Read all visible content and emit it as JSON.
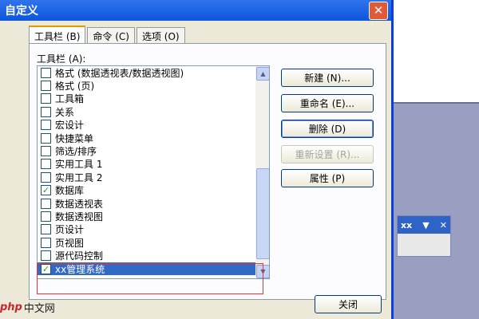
{
  "window": {
    "title": "自定义"
  },
  "tabs": [
    {
      "label": "工具栏 (B)",
      "active": true
    },
    {
      "label": "命令 (C)",
      "active": false
    },
    {
      "label": "选项 (O)",
      "active": false
    }
  ],
  "toolbars_label": "工具栏 (A):",
  "toolbars": [
    {
      "label": "格式 (数据透视表/数据透视图)",
      "checked": false
    },
    {
      "label": "格式 (页)",
      "checked": false
    },
    {
      "label": "工具箱",
      "checked": false
    },
    {
      "label": "关系",
      "checked": false
    },
    {
      "label": "宏设计",
      "checked": false
    },
    {
      "label": "快捷菜单",
      "checked": false
    },
    {
      "label": "筛选/排序",
      "checked": false
    },
    {
      "label": "实用工具 1",
      "checked": false
    },
    {
      "label": "实用工具 2",
      "checked": false
    },
    {
      "label": "数据库",
      "checked": true
    },
    {
      "label": "数据透视表",
      "checked": false
    },
    {
      "label": "数据透视图",
      "checked": false
    },
    {
      "label": "页设计",
      "checked": false
    },
    {
      "label": "页视图",
      "checked": false
    },
    {
      "label": "源代码控制",
      "checked": false
    },
    {
      "label": "xx管理系统",
      "checked": true,
      "selected": true
    }
  ],
  "buttons": {
    "new": "新建 (N)...",
    "rename": "重命名 (E)...",
    "delete": "删除 (D)",
    "reset": "重新设置 (R)...",
    "properties": "属性 (P)",
    "close": "关闭"
  },
  "mini_toolbar": {
    "title": "xx"
  },
  "watermark": {
    "logo": "php",
    "text": "中文网"
  },
  "colors": {
    "titlebar": "#0d55dc",
    "selection": "#316ac5",
    "highlight": "#e0363e"
  }
}
